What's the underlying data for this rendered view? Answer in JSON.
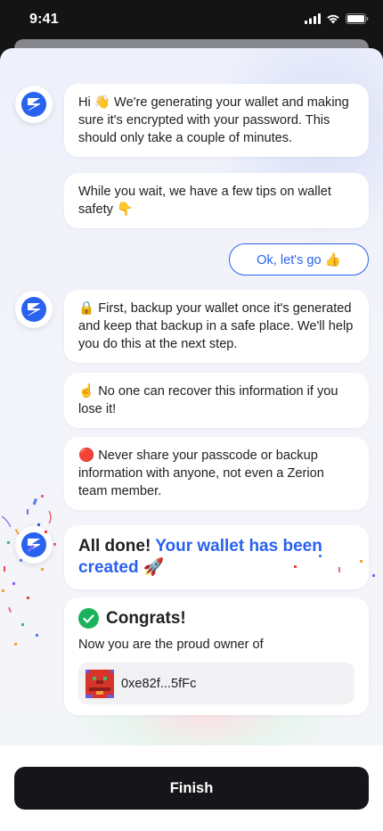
{
  "status_bar": {
    "time": "9:41",
    "icons": [
      "signal-icon",
      "wifi-icon",
      "battery-icon"
    ]
  },
  "brand": {
    "accent": "#2962ef",
    "success": "#18b35a",
    "finish_bg": "#16161a",
    "avatar_icon": "zerion-logo-icon"
  },
  "chat": {
    "messages_1": [
      "Hi 👋 We're generating your wallet and making sure it's encrypted with your password. This should only take a couple of minutes.",
      "While you wait, we have a few tips on wallet safety 👇"
    ],
    "reply_label": "Ok, let's go 👍",
    "messages_2": [
      "🔒 First, backup your wallet once it's generated and keep that backup in a safe place. We'll help you do this at the next step.",
      "☝️ No one can recover this information if you lose it!",
      "🔴 Never share your passcode or backup information with anyone, not even a Zerion team member."
    ],
    "done": {
      "prefix": "All done!",
      "highlight": "Your wallet has been created 🚀"
    },
    "congrats": {
      "title": "Congrats!",
      "subtitle": "Now you are the proud owner of",
      "wallet_address": "0xe82f...5fFc"
    }
  },
  "footer": {
    "finish_label": "Finish"
  }
}
